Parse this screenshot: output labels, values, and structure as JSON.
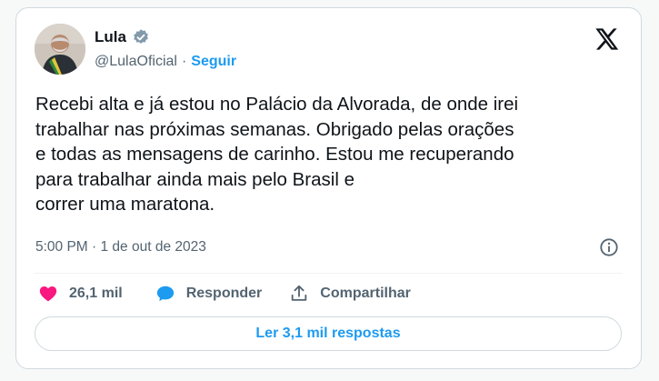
{
  "tweet": {
    "author_name": "Lula",
    "handle": "@LulaOficial",
    "separator": "·",
    "follow_label": "Seguir",
    "text": "Recebi alta e já estou no Palácio da Alvorada, de onde irei\ntrabalhar nas próximas semanas. Obrigado pelas orações\ne todas as mensagens de carinho. Estou me recuperando\npara trabalhar ainda mais pelo Brasil e\ncorrer uma maratona.",
    "timestamp": "5:00 PM · 1 de out de 2023"
  },
  "actions": {
    "likes_count": "26,1 mil",
    "reply_label": "Responder",
    "share_label": "Compartilhar"
  },
  "read_replies_label": "Ler 3,1 mil respostas",
  "icons": {
    "verified": "verified-badge-icon",
    "platform": "x-logo-icon",
    "info": "info-icon",
    "like": "heart-icon",
    "reply": "speech-bubble-icon",
    "share": "share-icon"
  },
  "colors": {
    "accent": "#1d9bf0",
    "like": "#f91880",
    "verified_badge": "#829aab",
    "muted_text": "#536471"
  }
}
